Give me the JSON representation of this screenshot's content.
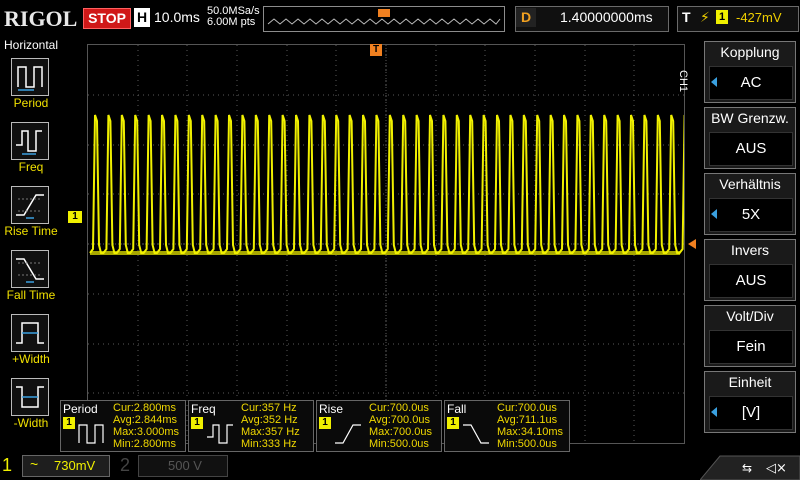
{
  "top": {
    "brand": "RIGOL",
    "run_state": "STOP",
    "timebase_label": "H",
    "timebase_value": "10.0ms",
    "sample_rate": "50.0MSa/s",
    "memory_depth": "6.00M pts",
    "delay_label": "D",
    "delay_value": "1.40000000ms",
    "trigger_label": "T",
    "trigger_channel": "1",
    "trigger_level": "-427mV"
  },
  "left_menu": {
    "title": "Horizontal",
    "items": [
      {
        "label": "Period",
        "icon": "period-icon"
      },
      {
        "label": "Freq",
        "icon": "frequency-icon"
      },
      {
        "label": "Rise Time",
        "icon": "rise-time-icon"
      },
      {
        "label": "Fall Time",
        "icon": "fall-time-icon"
      },
      {
        "label": "+Width",
        "icon": "positive-width-icon"
      },
      {
        "label": "-Width",
        "icon": "negative-width-icon"
      }
    ]
  },
  "right_menu": {
    "channel_tag": "CH1",
    "items": [
      {
        "title": "Kopplung",
        "value": "AC",
        "has_arrow": true
      },
      {
        "title": "BW Grenzw.",
        "value": "AUS",
        "has_arrow": false
      },
      {
        "title": "Verhältnis",
        "value": "5X",
        "has_arrow": true
      },
      {
        "title": "Invers",
        "value": "AUS",
        "has_arrow": false
      },
      {
        "title": "Volt/Div",
        "value": "Fein",
        "has_arrow": false
      },
      {
        "title": "Einheit",
        "value": "[V]",
        "has_arrow": true
      }
    ]
  },
  "waveform": {
    "channel_marker": "1",
    "trigger_marker": "T",
    "color": "#f0f000"
  },
  "measurements": [
    {
      "name": "Period",
      "channel": "1",
      "cur": "Cur:2.800ms",
      "avg": "Avg:2.844ms",
      "max": "Max:3.000ms",
      "min": "Min:2.800ms"
    },
    {
      "name": "Freq",
      "channel": "1",
      "cur": "Cur:357 Hz",
      "avg": "Avg:352 Hz",
      "max": "Max:357 Hz",
      "min": "Min:333 Hz"
    },
    {
      "name": "Rise",
      "channel": "1",
      "cur": "Cur:700.0us",
      "avg": "Avg:700.0us",
      "max": "Max:700.0us",
      "min": "Min:500.0us"
    },
    {
      "name": "Fall",
      "channel": "1",
      "cur": "Cur:700.0us",
      "avg": "Avg:711.1us",
      "max": "Max:34.10ms",
      "min": "Min:500.0us"
    }
  ],
  "bottom": {
    "ch1_number": "1",
    "ch1_coupling": "~",
    "ch1_scale": "730mV",
    "ch2_number": "2",
    "ch2_scale": "500 V"
  },
  "colors": {
    "ch1": "#f0f000",
    "stop": "#d01818",
    "accent": "#3aa0e0",
    "trigger": "#f08020"
  }
}
